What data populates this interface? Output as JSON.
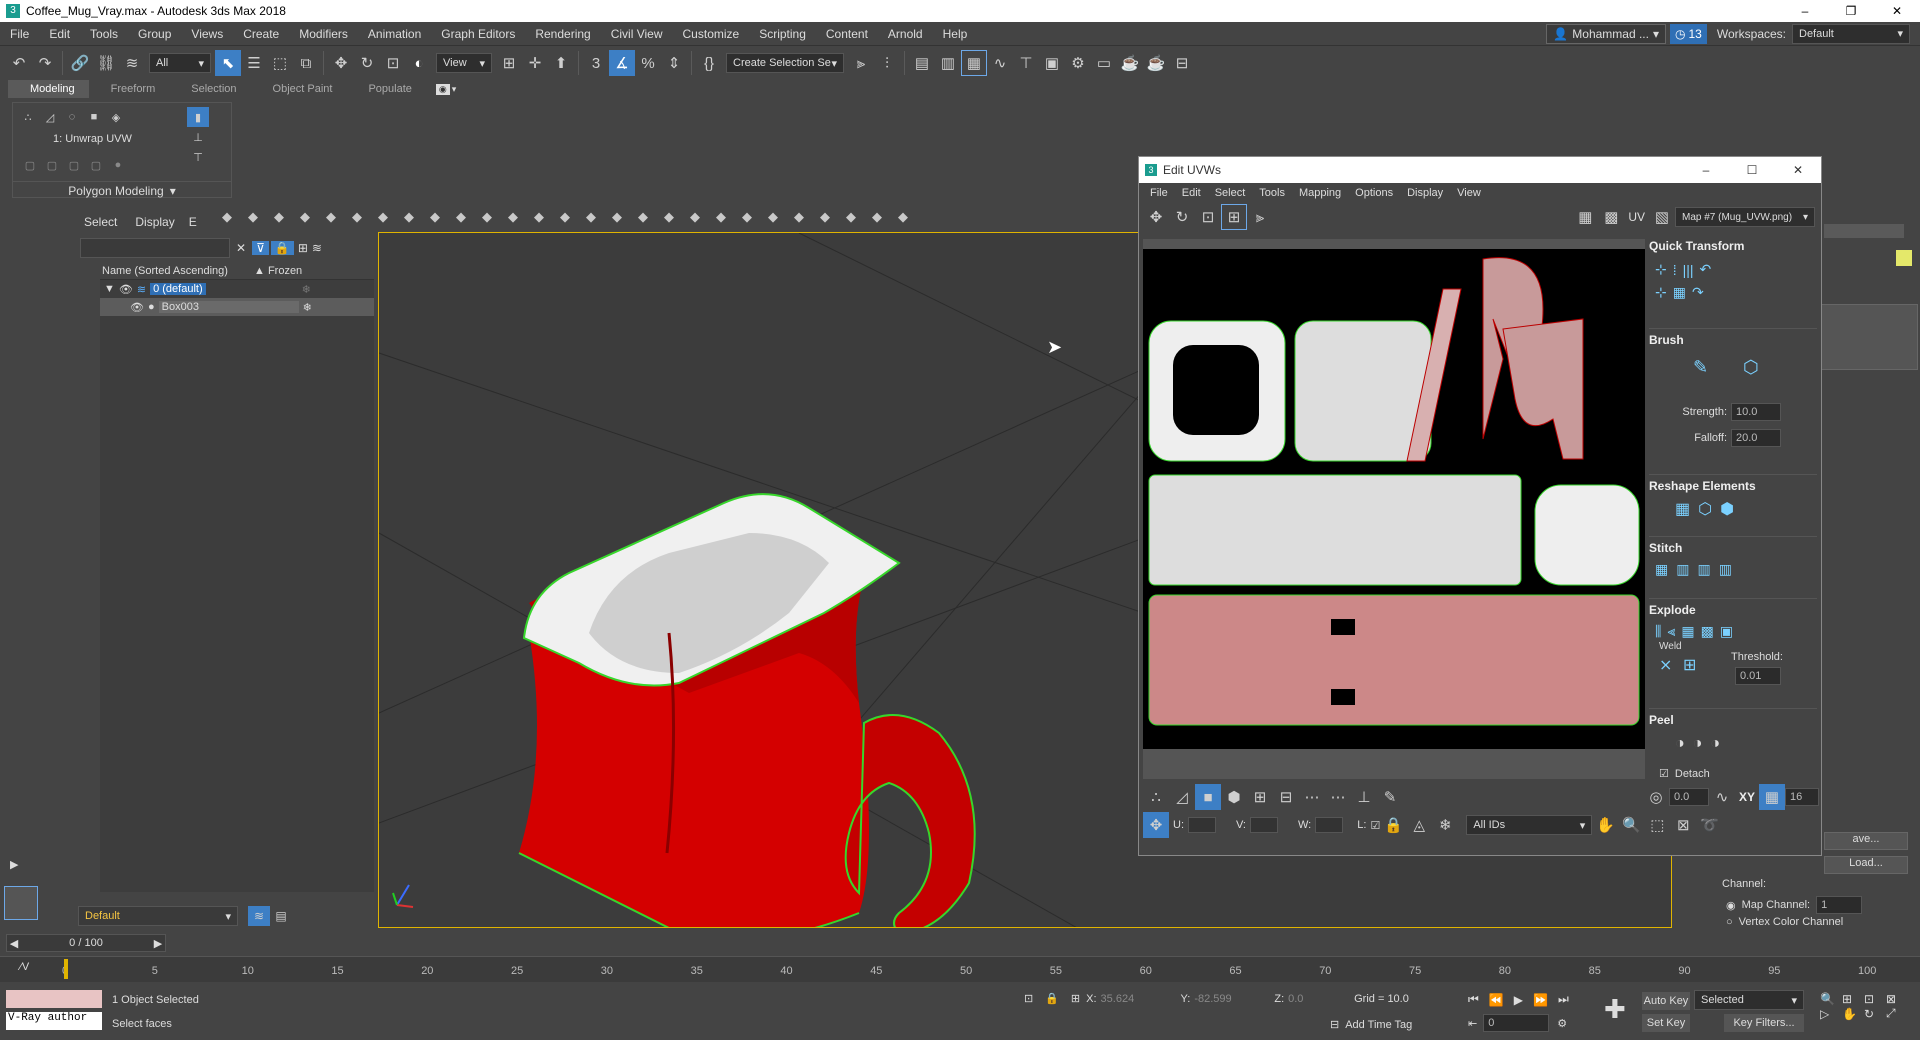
{
  "window": {
    "title": "Coffee_Mug_Vray.max - Autodesk 3ds Max 2018",
    "min": "–",
    "max": "❐",
    "close": "✕"
  },
  "menu": [
    "File",
    "Edit",
    "Tools",
    "Group",
    "Views",
    "Create",
    "Modifiers",
    "Animation",
    "Graph Editors",
    "Rendering",
    "Civil View",
    "Customize",
    "Scripting",
    "Content",
    "Arnold",
    "Help"
  ],
  "user": {
    "name": "Mohammad ...",
    "badge": "13",
    "workspaces_label": "Workspaces:",
    "workspace": "Default"
  },
  "toolbar": {
    "filter": "All",
    "view": "View",
    "selection_set": "Create Selection Se"
  },
  "ribbon": {
    "tabs": [
      "Modeling",
      "Freeform",
      "Selection",
      "Object Paint",
      "Populate"
    ],
    "modifier": "1: Unwrap UVW",
    "group": "Polygon Modeling"
  },
  "scene_explorer": {
    "tabs": [
      "Select",
      "Display",
      "E"
    ],
    "col_name": "Name (Sorted Ascending)",
    "col_frozen": "▲ Frozen",
    "layer": "0 (default)",
    "object": "Box003",
    "layer_dropdown": "Default"
  },
  "edit_uvw": {
    "title": "Edit UVWs",
    "menu": [
      "File",
      "Edit",
      "Select",
      "Tools",
      "Mapping",
      "Options",
      "Display",
      "View"
    ],
    "uv_label": "UV",
    "map": "Map #7 (Mug_UVW.png)",
    "quick_transform": "Quick Transform",
    "brush": "Brush",
    "strength_label": "Strength:",
    "strength": "10.0",
    "falloff_label": "Falloff:",
    "falloff": "20.0",
    "reshape": "Reshape Elements",
    "stitch": "Stitch",
    "explode": "Explode",
    "weld": "Weld",
    "threshold_label": "Threshold:",
    "threshold": "0.01",
    "peel": "Peel",
    "detach": "Detach",
    "rot_value": "0.0",
    "xy": "XY",
    "grid_count": "16",
    "u_label": "U:",
    "v_label": "V:",
    "w_label": "W:",
    "l_label": "L:",
    "ids": "All IDs"
  },
  "cmd_panel": {
    "save": "ave...",
    "load": "Load...",
    "channel": "Channel:",
    "map_channel_label": "Map Channel:",
    "map_channel": "1",
    "vertex_color": "Vertex Color Channel"
  },
  "timeline": {
    "frame": "0 / 100",
    "ticks": [
      "0",
      "5",
      "10",
      "15",
      "20",
      "25",
      "30",
      "35",
      "40",
      "45",
      "50",
      "55",
      "60",
      "65",
      "70",
      "75",
      "80",
      "85",
      "90",
      "95",
      "100"
    ]
  },
  "status": {
    "maxscript": "V-Ray author",
    "selected": "1 Object Selected",
    "prompt": "Select faces",
    "x_label": "X:",
    "x": "35.624",
    "y_label": "Y:",
    "y": "-82.599",
    "z_label": "Z:",
    "z": "0.0",
    "grid": "Grid = 10.0",
    "add_time_tag": "Add Time Tag",
    "auto_key": "Auto Key",
    "set_key": "Set Key",
    "key_mode": "Selected",
    "key_filters": "Key Filters...",
    "frame_field": "0"
  },
  "colors": {
    "mug": "#d40000",
    "select_green": "#37d62b",
    "bg": "#444444"
  }
}
